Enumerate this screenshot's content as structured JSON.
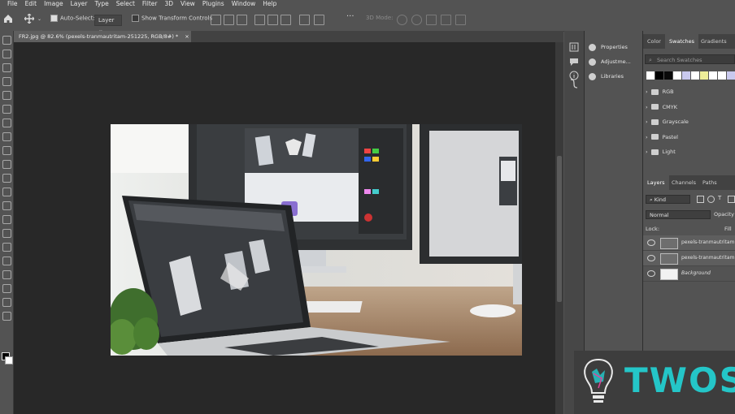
{
  "menu": [
    "File",
    "Edit",
    "Image",
    "Layer",
    "Type",
    "Select",
    "Filter",
    "3D",
    "View",
    "Plugins",
    "Window",
    "Help"
  ],
  "options_bar": {
    "auto_select_label": "Auto-Select:",
    "auto_select_value": "Layer",
    "show_transform_label": "Show Transform Controls",
    "mode_3d_label": "3D Mode:"
  },
  "document": {
    "tab_title": "FR2.jpg @ 82.6% (pexels-tranmautritam-251225, RGB/8#) *",
    "close_glyph": "×"
  },
  "properties_panel": {
    "items": [
      "Properties",
      "Adjustme...",
      "Libraries"
    ]
  },
  "swatches_panel": {
    "tabs": [
      "Color",
      "Swatches",
      "Gradients"
    ],
    "active_tab": "Swatches",
    "search_placeholder": "Search Swatches",
    "swatch_colors": [
      "#ffffff",
      "#000000",
      "#0a0a0a",
      "#ffffff",
      "#c9c9ee",
      "#ffffff",
      "#eeee99",
      "#ffffff",
      "#ffffff",
      "#c9c9ee"
    ],
    "folders": [
      "RGB",
      "CMYK",
      "Grayscale",
      "Pastel",
      "Light"
    ]
  },
  "layers_panel": {
    "tabs": [
      "Layers",
      "Channels",
      "Paths"
    ],
    "active_tab": "Layers",
    "filter_value": "Kind",
    "blend_mode": "Normal",
    "opacity_label": "Opacity",
    "lock_label": "Lock:",
    "fill_label": "Fill",
    "layers": [
      "pexels-tranmautritam...",
      "pexels-tranmautritam...",
      "Background"
    ]
  },
  "watermark": {
    "text": "TWOS",
    "colors": {
      "teal": "#24c6c8",
      "bg": "#3d3d3d"
    }
  }
}
